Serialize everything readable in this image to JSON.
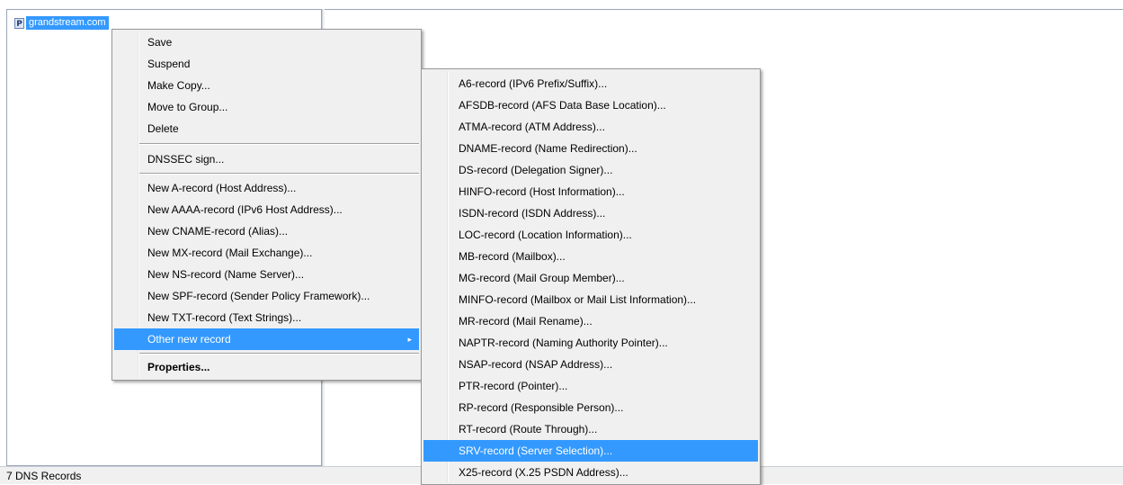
{
  "tree": {
    "node_label": "grandstream.com",
    "node_icon": "zone-icon",
    "node_icon_glyph": "P"
  },
  "status_bar": {
    "text": "7 DNS Records"
  },
  "context_menu": {
    "items": [
      {
        "label": "Save"
      },
      {
        "label": "Suspend"
      },
      {
        "label": "Make Copy..."
      },
      {
        "label": "Move to Group..."
      },
      {
        "label": "Delete"
      },
      {
        "label": "DNSSEC sign..."
      },
      {
        "label": "New A-record (Host Address)..."
      },
      {
        "label": "New AAAA-record (IPv6 Host Address)..."
      },
      {
        "label": "New CNAME-record (Alias)..."
      },
      {
        "label": "New MX-record (Mail Exchange)..."
      },
      {
        "label": "New NS-record (Name Server)..."
      },
      {
        "label": "New SPF-record (Sender Policy Framework)..."
      },
      {
        "label": "New TXT-record (Text Strings)..."
      },
      {
        "label": "Other new record",
        "highlighted": true,
        "submenu": true
      },
      {
        "label": "Properties...",
        "bold": true
      }
    ],
    "submenu_arrow": "▸"
  },
  "submenu": {
    "items": [
      {
        "label": "A6-record (IPv6 Prefix/Suffix)..."
      },
      {
        "label": "AFSDB-record (AFS Data Base Location)..."
      },
      {
        "label": "ATMA-record (ATM Address)..."
      },
      {
        "label": "DNAME-record (Name Redirection)..."
      },
      {
        "label": "DS-record (Delegation Signer)..."
      },
      {
        "label": "HINFO-record (Host Information)..."
      },
      {
        "label": "ISDN-record (ISDN Address)..."
      },
      {
        "label": "LOC-record (Location Information)..."
      },
      {
        "label": "MB-record (Mailbox)..."
      },
      {
        "label": "MG-record (Mail Group Member)..."
      },
      {
        "label": "MINFO-record (Mailbox or Mail List Information)..."
      },
      {
        "label": "MR-record (Mail Rename)..."
      },
      {
        "label": "NAPTR-record (Naming Authority Pointer)..."
      },
      {
        "label": "NSAP-record (NSAP Address)..."
      },
      {
        "label": "PTR-record (Pointer)..."
      },
      {
        "label": "RP-record (Responsible Person)..."
      },
      {
        "label": "RT-record (Route Through)..."
      },
      {
        "label": "SRV-record (Server Selection)...",
        "highlighted": true
      },
      {
        "label": "X25-record (X.25 PSDN Address)..."
      }
    ]
  },
  "colors": {
    "highlight": "#3399ff",
    "menu_background": "#f0f0f0"
  }
}
